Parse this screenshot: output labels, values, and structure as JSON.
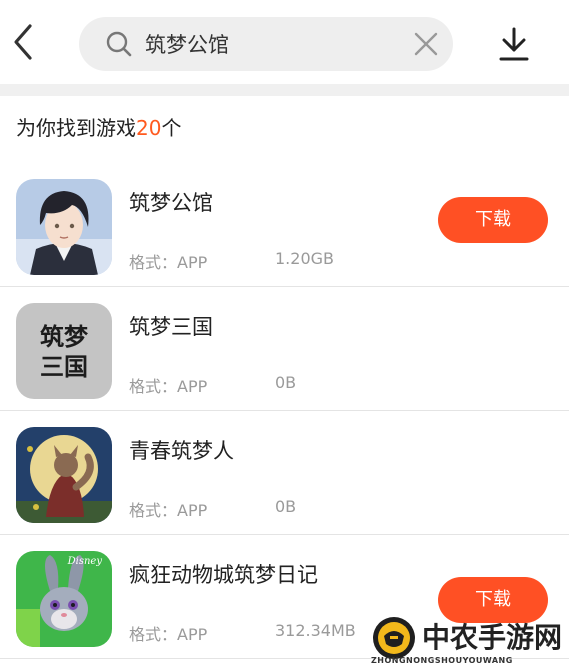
{
  "search": {
    "value": "筑梦公馆",
    "placeholder": "筑梦公馆"
  },
  "results": {
    "prefix": "为你找到游戏",
    "count": "20",
    "suffix": "个"
  },
  "items": [
    {
      "name": "筑梦公馆",
      "format": "格式：APP",
      "size": "1.20GB",
      "button": "下载",
      "icon": "anime-character-icon"
    },
    {
      "name": "筑梦三国",
      "format": "格式：APP",
      "size": "0B",
      "icon": "calligraphy-icon"
    },
    {
      "name": "青春筑梦人",
      "format": "格式：APP",
      "size": "0B",
      "icon": "fox-moon-icon"
    },
    {
      "name": "疯狂动物城筑梦日记",
      "format": "格式：APP",
      "size": "312.34MB",
      "button": "下载",
      "icon": "rabbit-icon"
    }
  ],
  "icon_texts": {
    "calligraphy": [
      "筑梦",
      "三国"
    ],
    "disney": "Disney"
  },
  "watermark": {
    "title": "中农手游网",
    "subtitle": "ZHONGNONGSHOUYOUWANG"
  },
  "colors": {
    "accent": "#ff5024",
    "count": "#ff5a1f"
  }
}
